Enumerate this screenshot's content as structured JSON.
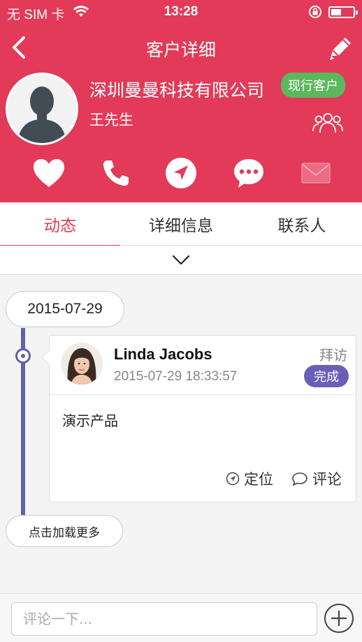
{
  "status_bar": {
    "carrier": "无 SIM 卡",
    "time": "13:28"
  },
  "header": {
    "title": "客户详细",
    "company_name": "深圳曼曼科技有限公司",
    "contact_name": "王先生",
    "status_badge": "现行客户",
    "accent_color": "#e23a58",
    "badge_color": "#5cb85c"
  },
  "actions": [
    {
      "icon": "heart-icon"
    },
    {
      "icon": "phone-icon"
    },
    {
      "icon": "navigation-icon"
    },
    {
      "icon": "message-icon"
    },
    {
      "icon": "mail-icon"
    }
  ],
  "tabs": [
    {
      "label": "动态",
      "active": true
    },
    {
      "label": "详细信息",
      "active": false
    },
    {
      "label": "联系人",
      "active": false
    }
  ],
  "timeline": {
    "date": "2015-07-29",
    "line_color": "#6161a8",
    "card": {
      "name": "Linda Jacobs",
      "time": "2015-07-29 18:33:57",
      "type": "拜访",
      "status": "完成",
      "status_color": "#6a5fb8",
      "content": "演示产品",
      "location_label": "定位",
      "comment_label": "评论"
    },
    "load_more": "点击加载更多"
  },
  "bottom_bar": {
    "placeholder": "评论一下..."
  }
}
